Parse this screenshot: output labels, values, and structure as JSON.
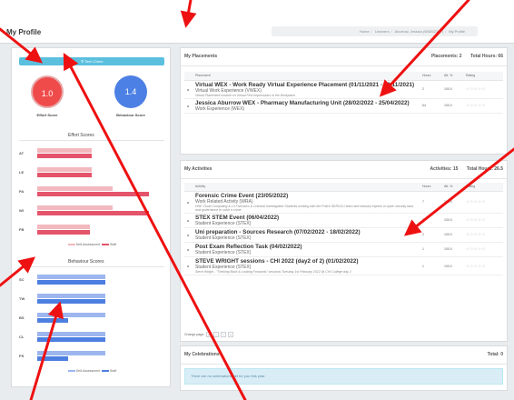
{
  "header": {
    "page_title": "My Profile",
    "breadcrumb": [
      "Home",
      "Learners",
      "Aburrow, Jessica (W0202107)",
      "My Profile"
    ]
  },
  "left": {
    "button_label": "Tech Chem",
    "effort_score": {
      "value": "1.0",
      "label": "Effort Score"
    },
    "behaviour_score": {
      "value": "1.4",
      "label": "Behaviour Score"
    },
    "effort_chart_title": "Effort Scores",
    "behaviour_chart_title": "Behaviour Scores",
    "legend": {
      "self": "Self-Assessment",
      "staff": "Staff"
    }
  },
  "chart_data": [
    {
      "type": "bar",
      "title": "Effort Scores",
      "categories": [
        "AT",
        "LE",
        "PA",
        "WI",
        "FB"
      ],
      "series": [
        {
          "name": "Self-Assessment",
          "values": [
            0.45,
            0.45,
            0.62,
            0.62,
            0.43
          ]
        },
        {
          "name": "Staff",
          "values": [
            0.45,
            0.45,
            0.92,
            0.92,
            0.43
          ]
        }
      ],
      "colors": {
        "Self-Assessment": "#f2b9bf",
        "Staff": "#e4546b"
      }
    },
    {
      "type": "bar",
      "title": "Behaviour Scores",
      "categories": [
        "SC",
        "TW",
        "BS",
        "CL",
        "PS"
      ],
      "series": [
        {
          "name": "Self-Assessment",
          "values": [
            0.56,
            0.56,
            0.56,
            0.56,
            0.56
          ]
        },
        {
          "name": "Staff",
          "values": [
            0.56,
            0.56,
            0.25,
            0.56,
            0.25
          ]
        }
      ],
      "colors": {
        "Self-Assessment": "#9db6ef",
        "Staff": "#4d7fe0"
      }
    }
  ],
  "placements": {
    "title": "My Placements",
    "stats": {
      "count": "Placements: 2",
      "hours": "Total Hours: 66"
    },
    "columns": [
      "Placement",
      "Hours",
      "Att. %",
      "Rating"
    ],
    "rows": [
      {
        "title": "Virtual WEX - Work Ready Virtual Experience Placement (01/11/2021 - 12/11/2021)",
        "type": "Virtual Work Experience (VWEX)",
        "desc": "Virtual Placement module on Virtual First Impressions in the Workplace",
        "hours": "2",
        "att": "100.0",
        "rating": "☆☆☆☆☆"
      },
      {
        "title": "Jessica Aburrow WEX - Pharmacy Manufacturing Unit (28/02/2022 - 25/04/2022)",
        "type": "Work Experience (WEX)",
        "desc": "",
        "hours": "64",
        "att": "100.0",
        "rating": "☆☆☆☆☆"
      }
    ]
  },
  "activities": {
    "title": "My Activities",
    "stats": {
      "count": "Activities: 15",
      "hours": "Total Hours: 26.5"
    },
    "columns": [
      "Activity",
      "Hours",
      "Att. %",
      "Rating"
    ],
    "rows": [
      {
        "title": "Forensic Crime Event (23/05/2022)",
        "type": "Work Related Activity (WRA)",
        "desc": "HNE Cloud Computing & L3 Forensics & Criminal Investigation Students working with the Police SEROCU team and industry experts in cyber security laws and governance to solve a crime",
        "hours": "7",
        "att": "100.0",
        "rating": "☆☆☆☆☆"
      },
      {
        "title": "STEX STEM Event (06/04/2022)",
        "type": "Student Experience (STEX)",
        "desc": "",
        "hours": "3",
        "att": "100.0",
        "rating": "☆☆☆☆☆"
      },
      {
        "title": "Uni preparation - Sources Research (07/02/2022 - 18/02/2022)",
        "type": "Student Experience (STEX)",
        "desc": "",
        "hours": "2",
        "att": "100.0",
        "rating": "☆☆☆☆☆"
      },
      {
        "title": "Post Exam Reflection Task (04/02/2022)",
        "type": "Student Experience (STEX)",
        "desc": "",
        "hours": "1",
        "att": "100.0",
        "rating": "☆☆☆☆☆"
      },
      {
        "title": "STEVE WRIGHT sessions - CHI 2022 (day2 of 2) (01/02/2022)",
        "type": "Student Experience (STEX)",
        "desc": "Steve Wright - \"Thinking Back & Looking Forwards\" sessions Tuesday 1st February 2022 @ CHI College day 2",
        "hours": "1",
        "att": "100.0",
        "rating": "☆☆☆☆☆"
      }
    ],
    "pager": {
      "label": "Change page:",
      "buttons": [
        "«",
        "‹",
        "›",
        "»"
      ]
    }
  },
  "celebrations": {
    "title": "My Celebrations",
    "total": "Total: 0",
    "notice": "There are no celebrations yet for you this year."
  },
  "annotation_color": "#ee1111"
}
